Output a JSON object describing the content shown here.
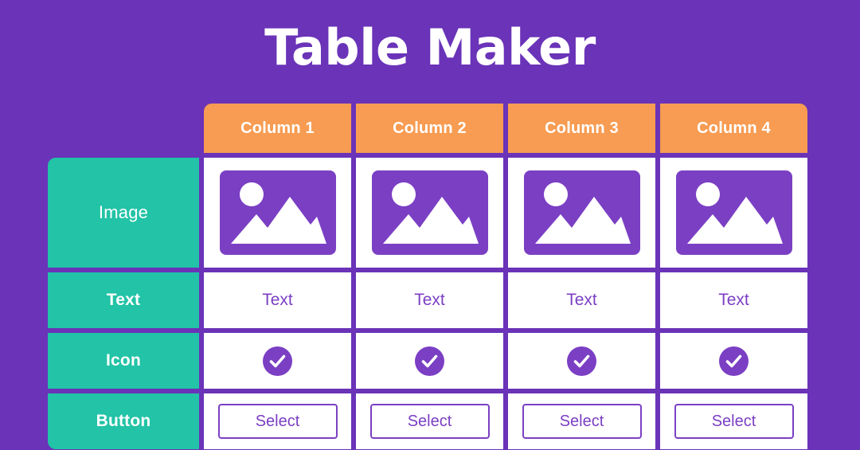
{
  "page": {
    "title": "Table Maker",
    "background_color": "#6a33b8",
    "header_color": "#f79c52",
    "label_color": "#22c3a6",
    "accent_color": "#7b3fc4",
    "cell_color": "#ffffff"
  },
  "table": {
    "corner_label": "",
    "columns": [
      {
        "label": "Column 1"
      },
      {
        "label": "Column 2"
      },
      {
        "label": "Column 3"
      },
      {
        "label": "Column 4"
      }
    ],
    "rows": [
      {
        "label": "Image",
        "type": "image",
        "cells": [
          {
            "icon": "image-placeholder-icon"
          },
          {
            "icon": "image-placeholder-icon"
          },
          {
            "icon": "image-placeholder-icon"
          },
          {
            "icon": "image-placeholder-icon"
          }
        ]
      },
      {
        "label": "Text",
        "type": "text",
        "cells": [
          {
            "value": "Text"
          },
          {
            "value": "Text"
          },
          {
            "value": "Text"
          },
          {
            "value": "Text"
          }
        ]
      },
      {
        "label": "Icon",
        "type": "icon",
        "cells": [
          {
            "icon": "check-circle-icon"
          },
          {
            "icon": "check-circle-icon"
          },
          {
            "icon": "check-circle-icon"
          },
          {
            "icon": "check-circle-icon"
          }
        ]
      },
      {
        "label": "Button",
        "type": "button",
        "cells": [
          {
            "value": "Select"
          },
          {
            "value": "Select"
          },
          {
            "value": "Select"
          },
          {
            "value": "Select"
          }
        ]
      }
    ]
  }
}
